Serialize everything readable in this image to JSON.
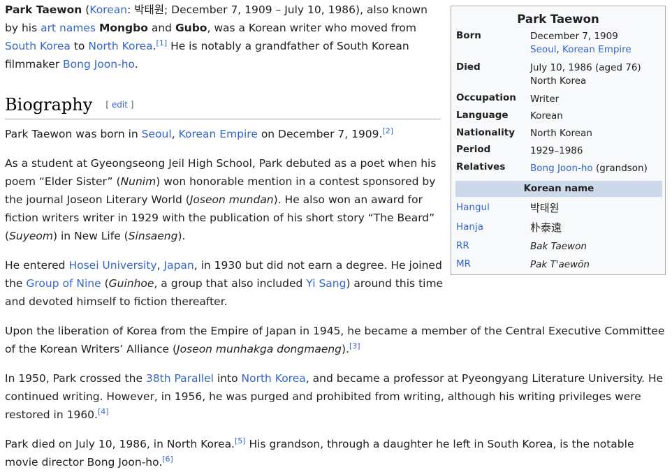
{
  "lead": {
    "name_bold": "Park Taewon",
    "korean_link": "Korean",
    "after_korean": ": 박태원; December 7, 1909 – July 10, 1986), also known by his",
    "art_names_link": "art names",
    "mongbo": "Mongbo",
    "and": "and",
    "gubo": "Gubo",
    "mid": ", was a Korean writer who moved from",
    "south_korea_link": "South Korea",
    "to": "to",
    "north_korea_link": "North Korea",
    "ref1": "[1]",
    "tail": "He is notably a grandfather of South Korean filmmaker",
    "bong_link": "Bong Joon-ho",
    "end": "."
  },
  "heading": {
    "title": "Biography",
    "edit_open": "[ ",
    "edit_label": "edit",
    "edit_close": " ]"
  },
  "p1": {
    "a": "Park Taewon was born in",
    "seoul": "Seoul",
    "comma": ",",
    "empire": "Korean Empire",
    "b": "on December 7, 1909.",
    "ref": "[2]"
  },
  "p2": {
    "a": "As a student at Gyeongseong Jeil High School, Park debuted as a poet when his poem “Elder Sister” (",
    "nunim": "Nunim",
    "b": ") won honorable mention in a contest sponsored by the journal Joseon Literary World (",
    "joseon_mundan": "Joseon mundan",
    "c": "). He also won an award for fiction writers writer in 1929 with the publication of his short story “The Beard” (",
    "suyeom": "Suyeom",
    "d": ") in New Life (",
    "sinsaeng": "Sinsaeng",
    "e": ")."
  },
  "p3": {
    "a": "He entered",
    "hosei": "Hosei University",
    "comma": ",",
    "japan": "Japan",
    "b": ", in 1930 but did not earn a degree. He joined the",
    "group": "Group of Nine",
    "c": "(",
    "guinhoe": "Guinhoe",
    "d": ", a group that also included",
    "yisang": "Yi Sang",
    "e": ") around this time and devoted himself to fiction thereafter."
  },
  "p4": {
    "a": "Upon the liberation of Korea from the Empire of Japan in 1945, he became a member of the Central Executive Committee of the Korean Writers’ Alliance (",
    "joseon_munhakga": "Joseon munhakga dongmaeng",
    "b": ").",
    "ref": "[3]"
  },
  "p5": {
    "a": "In 1950, Park crossed the",
    "parallel": "38th Parallel",
    "b": "into",
    "north_korea": "North Korea",
    "c": ", and became a professor at Pyeongyang Literature University. He continued writing. However, in 1956, he was purged and prohibited from writing, although his writing privileges were restored in 1960.",
    "ref": "[4]"
  },
  "p6": {
    "a": "Park died on July 10, 1986, in North Korea.",
    "ref5": "[5]",
    "b": "His grandson, through a daughter he left in South Korea, is the notable movie director Bong Joon-ho.",
    "ref6": "[6]"
  },
  "infobox": {
    "title": "Park Taewon",
    "born_label": "Born",
    "born_date": "December 7, 1909",
    "born_seoul": "Seoul",
    "born_comma": ",",
    "born_empire": "Korean Empire",
    "died_label": "Died",
    "died_date": "July 10, 1986 (aged 76)",
    "died_place": "North Korea",
    "occupation_label": "Occupation",
    "occupation": "Writer",
    "language_label": "Language",
    "language": "Korean",
    "nationality_label": "Nationality",
    "nationality": "North Korean",
    "period_label": "Period",
    "period": "1929–1986",
    "relatives_label": "Relatives",
    "relatives_link": "Bong Joon-ho",
    "relatives_note": "(grandson)",
    "korean_name_header": "Korean name",
    "hangul_label": "Hangul",
    "hangul": "박태원",
    "hanja_label": "Hanja",
    "hanja": "朴泰遠",
    "rr_label": "RR",
    "rr": "Bak Taewon",
    "mr_label": "MR",
    "mr": "Pak T'aewŏn"
  }
}
